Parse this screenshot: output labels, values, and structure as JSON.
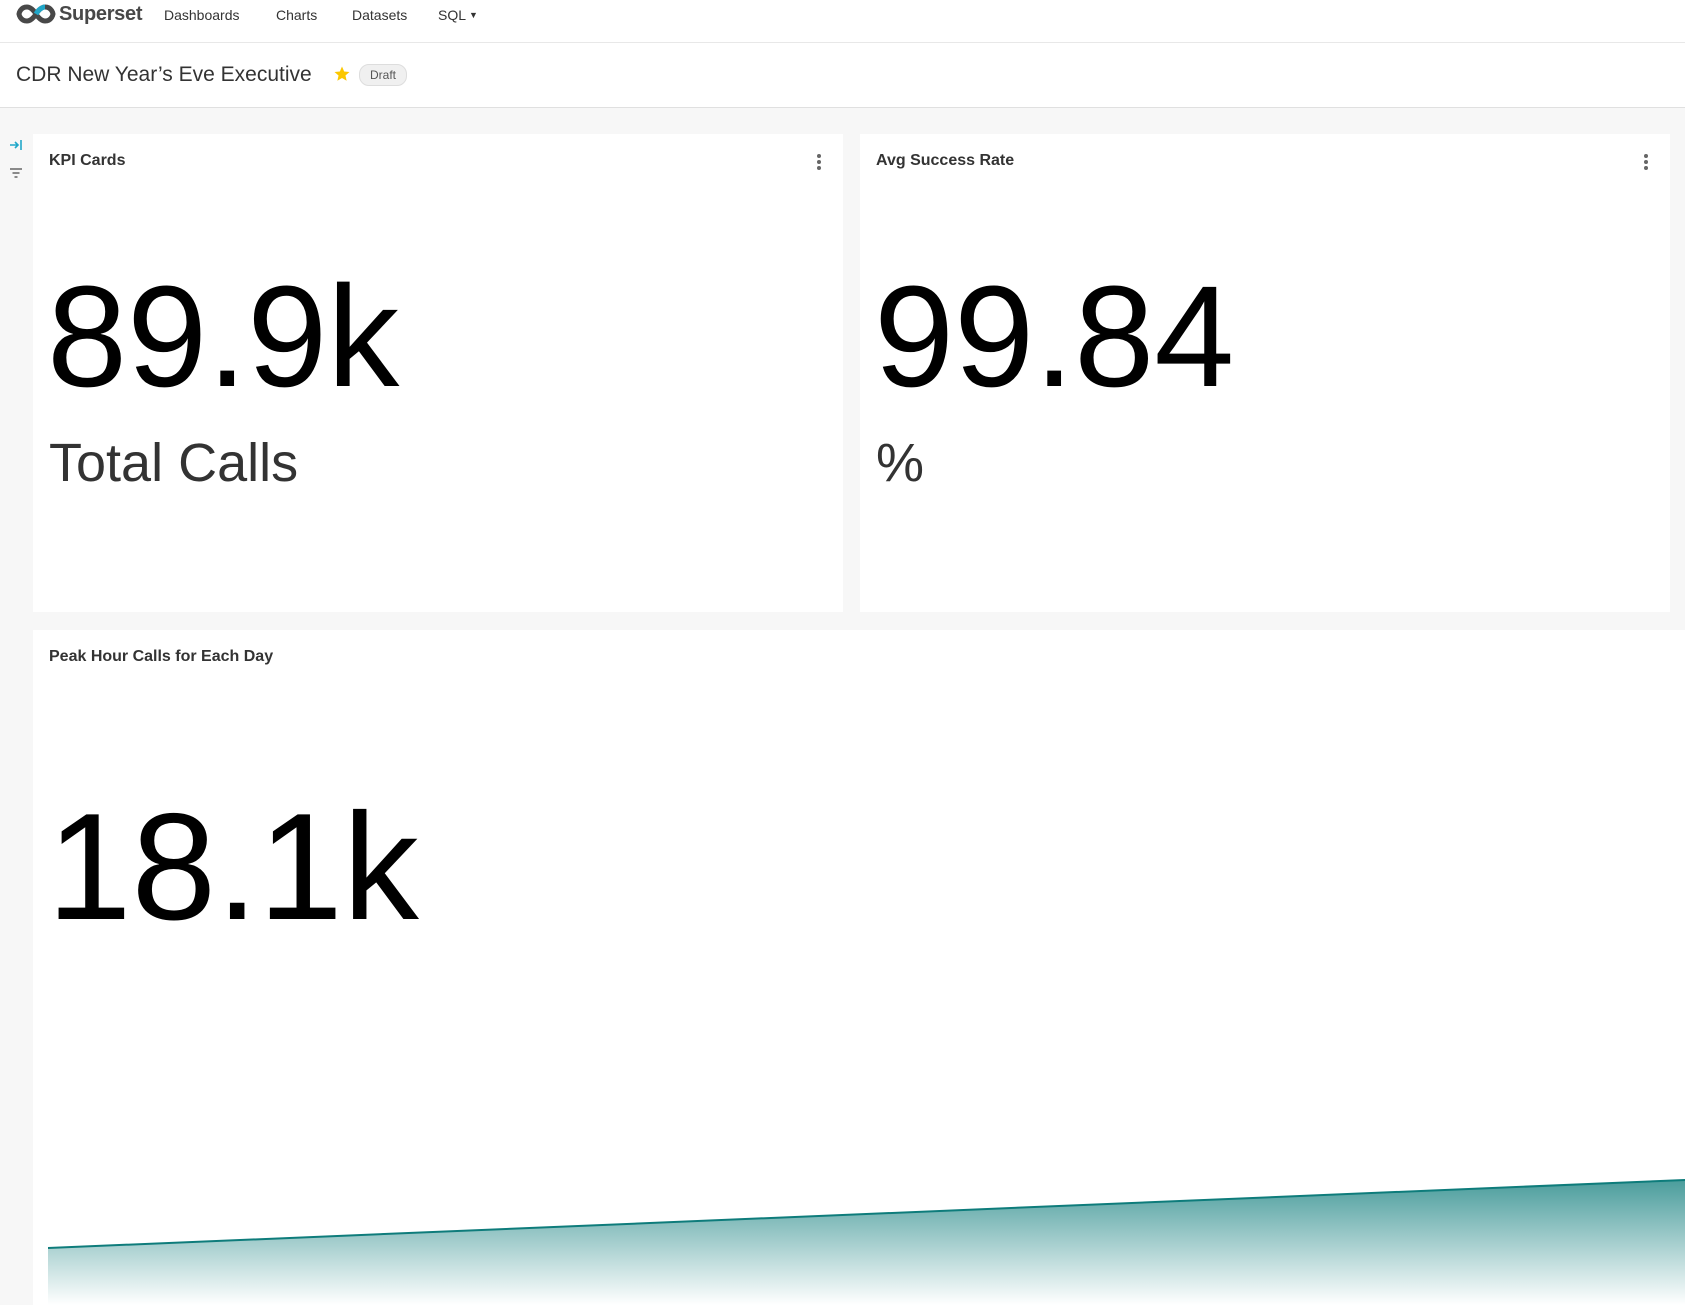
{
  "app": {
    "name": "Superset"
  },
  "nav": {
    "dashboards": "Dashboards",
    "charts": "Charts",
    "datasets": "Datasets",
    "sql": "SQL"
  },
  "dashboard": {
    "title": "CDR New Year’s Eve Executive",
    "status": "Draft"
  },
  "cards": {
    "kpi": {
      "title": "KPI Cards",
      "value": "89.9k",
      "subheader": "Total Calls"
    },
    "success": {
      "title": "Avg Success Rate",
      "value": "99.84",
      "subheader": "%"
    },
    "peak": {
      "title": "Peak Hour Calls for Each Day",
      "value": "18.1k"
    }
  },
  "colors": {
    "accent": "#20a7c9",
    "trendline": "#0e7c7b",
    "star": "#fbc700"
  },
  "chart_data": {
    "type": "area",
    "title": "Peak Hour Calls for Each Day",
    "big_number": "18.1k",
    "series": [
      {
        "values": [
          0.0,
          1.0
        ]
      }
    ],
    "trend": "increasing"
  }
}
